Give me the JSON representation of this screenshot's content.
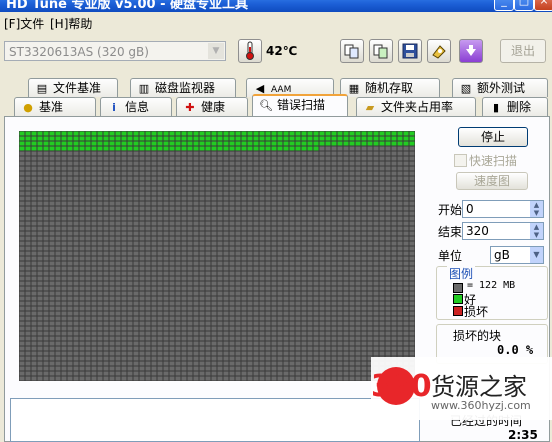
{
  "window": {
    "title": "HD Tune 专业版 v5.00 - 硬盘专业工具",
    "buttons": [
      "_",
      "□",
      "×"
    ]
  },
  "menu": [
    "[F]文件",
    "[H]帮助"
  ],
  "toolbar": {
    "drive": "ST3320613AS (320 gB)",
    "temperature": "42℃",
    "icons": [
      "thermometer-icon",
      "copy-icon",
      "copy-all-icon",
      "save-icon",
      "screenshot-icon",
      "options-icon"
    ],
    "exit_label": "退出"
  },
  "tabs_row1": [
    {
      "label": "文件基准",
      "icon": "file-icon"
    },
    {
      "label": "磁盘监视器",
      "icon": "monitor-icon"
    },
    {
      "label": "AAM",
      "icon": "speaker-icon"
    },
    {
      "label": "随机存取",
      "icon": "random-access-icon"
    },
    {
      "label": "额外测试",
      "icon": "extra-tests-icon"
    }
  ],
  "tabs_row2": [
    {
      "label": "基准",
      "icon": "benchmark-icon"
    },
    {
      "label": "信息",
      "icon": "info-icon"
    },
    {
      "label": "健康",
      "icon": "health-icon"
    },
    {
      "label": "错误扫描",
      "icon": "magnifier-icon",
      "active": true
    },
    {
      "label": "文件夹占用率",
      "icon": "folder-icon"
    },
    {
      "label": "删除",
      "icon": "trash-icon"
    }
  ],
  "scan": {
    "stop_label": "停止",
    "quick_scan_label": "快速扫描",
    "speed_map_label": "速度图",
    "start_label": "开始",
    "start_value": "0",
    "end_label": "结束",
    "end_value": "320",
    "unit_label": "单位",
    "unit_value": "gB",
    "legend_title": "图例",
    "legend_block": "= 122 MB",
    "legend_good": "好",
    "legend_bad": "损坏",
    "bad_blocks_label": "损坏的块",
    "bad_blocks_value": "0.0 %",
    "elapsed_label": "已经过的时间",
    "elapsed_value": "2:35",
    "grid_progress": 0.075,
    "colors": {
      "pending": "#6a6a6a",
      "good": "#22cc22",
      "bad": "#cc2222",
      "grid_line": "#3a3a3a"
    }
  },
  "watermark": {
    "number": "360",
    "name": "货源之家",
    "url": "www.360hyzj.com"
  }
}
